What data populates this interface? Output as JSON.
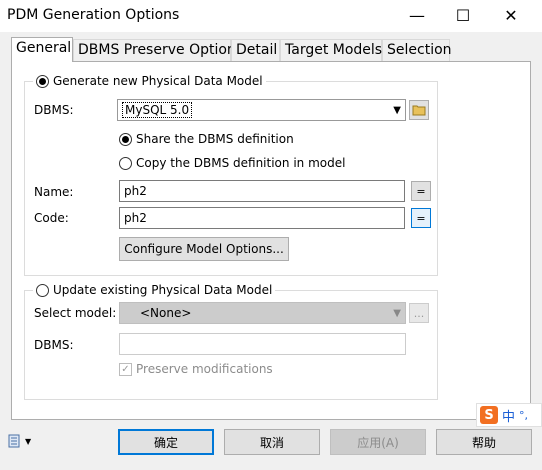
{
  "window": {
    "title": "PDM Generation Options",
    "minimize_glyph": "—",
    "maximize_glyph": "☐",
    "close_glyph": "✕"
  },
  "tabs": [
    {
      "label": "General",
      "active": true
    },
    {
      "label": "DBMS Preserve Options",
      "active": false
    },
    {
      "label": "Detail",
      "active": false
    },
    {
      "label": "Target Models",
      "active": false
    },
    {
      "label": "Selection",
      "active": false
    }
  ],
  "generate_group": {
    "radio_label": "Generate new Physical Data Model",
    "selected": true,
    "dbms_label": "DBMS:",
    "dbms_value": "MySQL 5.0",
    "share_label": "Share the DBMS definition",
    "share_selected": true,
    "copy_label": "Copy the DBMS definition in model",
    "copy_selected": false,
    "name_label": "Name:",
    "name_value": "ph2",
    "code_label": "Code:",
    "code_value": "ph2",
    "equals_glyph": "=",
    "configure_button": "Configure Model Options..."
  },
  "update_group": {
    "radio_label": "Update existing Physical Data Model",
    "selected": false,
    "select_model_label": "Select model:",
    "select_model_value": "<None>",
    "ellipsis": "...",
    "dbms_label": "DBMS:",
    "dbms_value": "",
    "preserve_label": "Preserve modifications",
    "preserve_checked": true
  },
  "ime": {
    "logo": "S",
    "chinese": "中",
    "punct": "°,"
  },
  "footer": {
    "ok": "确定",
    "cancel": "取消",
    "apply": "应用(A)",
    "help": "帮助"
  }
}
